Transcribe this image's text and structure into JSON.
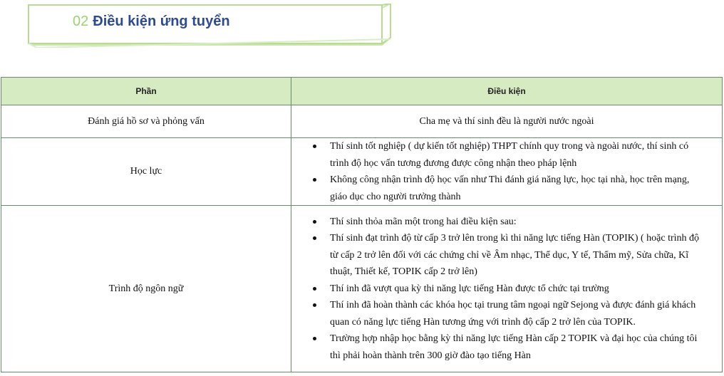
{
  "header": {
    "number": "02",
    "title": "Điều kiện ứng tuyển"
  },
  "table": {
    "headers": [
      "Phần",
      "Điều kiện"
    ],
    "rows": [
      {
        "label": "Đánh giá hồ sơ và phỏng vấn",
        "text": "Cha mẹ và thí sinh đều là người nước ngoài"
      },
      {
        "label": "Học lực",
        "items": [
          "Thí sinh tốt nghiệp ( dự kiến tốt nghiệp) THPT chính quy trong và ngoài nước, thí sinh có trình độ học vấn tương đương được công nhận theo pháp lệnh",
          "Không công nhận trình độ học vấn như Thi đánh giá năng lực, học tại nhà, học trên mạng, giáo dục cho người trưởng thành"
        ]
      },
      {
        "label": "Trình độ ngôn ngữ",
        "items": [
          "Thí sinh thỏa mãn một trong hai điều kiện sau:",
          "Thí sinh đạt trình độ từ cấp 3 trở lên trong kì thi năng lực tiếng Hàn (TOPIK) ( hoặc trình độ từ cấp 2 trở lên đối với các chứng chỉ về Âm nhạc, Thể dục, Y tế, Thẩm mỹ, Sửa chữa, Kĩ thuật, Thiết kế, TOPIK cấp 2 trở lên)",
          "Thí inh đã vượt qua kỳ thi năng lực tiếng Hàn được tổ chức tại trường",
          "Thí inh đã hoàn thành các khóa học tại trung tâm ngoại ngữ Sejong và được đánh giá khách quan có năng lực tiếng Hàn tương ứng với trình độ cấp 2 trở lên của TOPIK.",
          "Trường hợp nhập học bằng kỳ thi năng lực tiếng Hàn cấp 2 TOPIK và đại học của chúng tôi thì phải hoàn thành trên 300 giờ đào tạo tiếng Hàn"
        ]
      }
    ]
  }
}
